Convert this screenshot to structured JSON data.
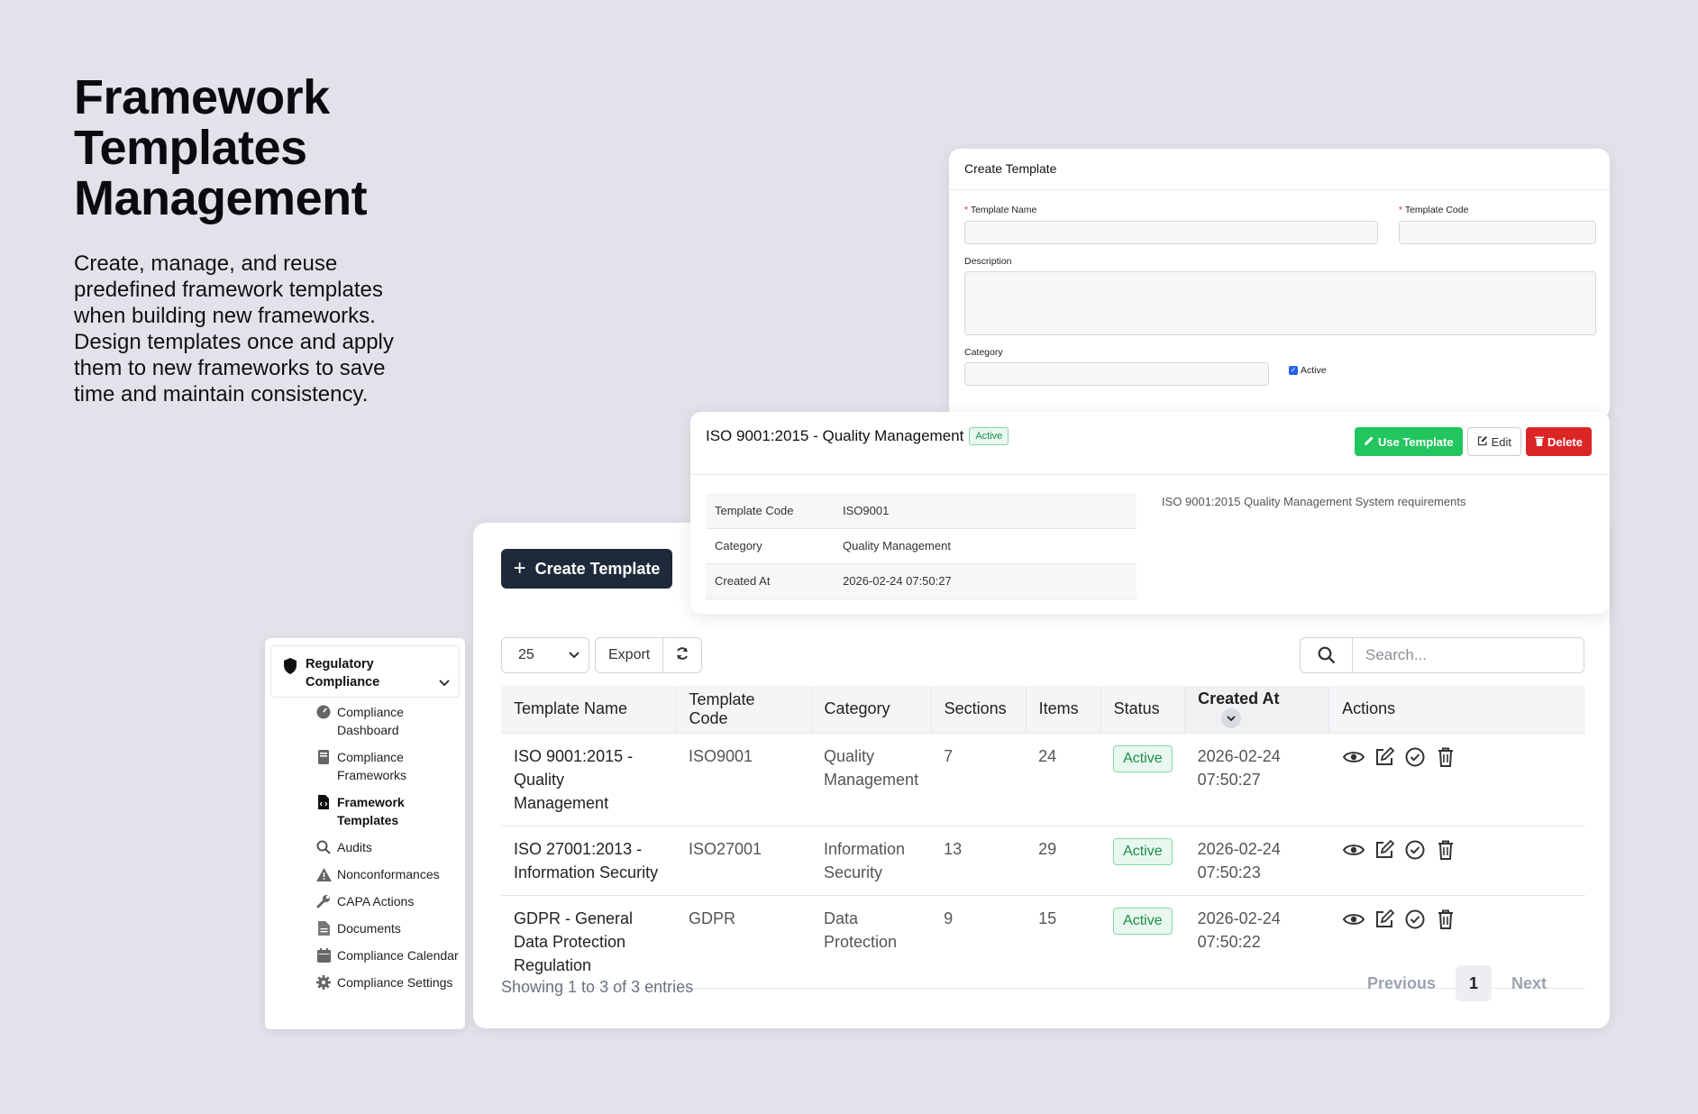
{
  "hero": {
    "title": "Framework Templates Management",
    "description": "Create, manage, and reuse predefined framework templates when building new frameworks. Design templates once and apply them to new frameworks to save time and maintain consistency."
  },
  "sidebar": {
    "section_title": "Regulatory Compliance",
    "items": [
      {
        "label": "Compliance Dashboard",
        "icon": "dashboard-icon"
      },
      {
        "label": "Compliance Frameworks",
        "icon": "book-icon"
      },
      {
        "label": "Framework Templates",
        "icon": "file-code-icon",
        "active": true
      },
      {
        "label": "Audits",
        "icon": "search-icon"
      },
      {
        "label": "Nonconformances",
        "icon": "warning-icon"
      },
      {
        "label": "CAPA Actions",
        "icon": "wrench-icon"
      },
      {
        "label": "Documents",
        "icon": "document-icon"
      },
      {
        "label": "Compliance Calendar",
        "icon": "calendar-icon"
      },
      {
        "label": "Compliance Settings",
        "icon": "gear-icon"
      }
    ]
  },
  "toolbar": {
    "create_label": "Create Template",
    "page_size": "25",
    "export_label": "Export",
    "search_placeholder": "Search..."
  },
  "table": {
    "columns": [
      "Template Name",
      "Template Code",
      "Category",
      "Sections",
      "Items",
      "Status",
      "Created At",
      "Actions"
    ],
    "rows": [
      {
        "name": "ISO 9001:2015 - Quality Management",
        "code": "ISO9001",
        "category": "Quality Management",
        "sections": "7",
        "items": "24",
        "status": "Active",
        "created": "2026-02-24 07:50:27"
      },
      {
        "name": "ISO 27001:2013 - Information Security",
        "code": "ISO27001",
        "category": "Information Security",
        "sections": "13",
        "items": "29",
        "status": "Active",
        "created": "2026-02-24 07:50:23"
      },
      {
        "name": "GDPR - General Data Protection Regulation",
        "code": "GDPR",
        "category": "Data Protection",
        "sections": "9",
        "items": "15",
        "status": "Active",
        "created": "2026-02-24 07:50:22"
      }
    ]
  },
  "footer": {
    "showing": "Showing 1 to 3 of 3 entries",
    "previous": "Previous",
    "page": "1",
    "next": "Next"
  },
  "create_form": {
    "title": "Create Template",
    "name_label": "Template Name",
    "code_label": "Template Code",
    "description_label": "Description",
    "category_label": "Category",
    "active_label": "Active",
    "required_mark": "*"
  },
  "detail": {
    "title": "ISO 9001:2015 - Quality Management",
    "status": "Active",
    "use_label": "Use Template",
    "edit_label": "Edit",
    "delete_label": "Delete",
    "fields": [
      {
        "key": "Template Code",
        "value": "ISO9001"
      },
      {
        "key": "Category",
        "value": "Quality Management"
      },
      {
        "key": "Created At",
        "value": "2026-02-24 07:50:27"
      }
    ],
    "description": "ISO 9001:2015 Quality Management System requirements"
  },
  "colors": {
    "primary_dark": "#1e2a3a",
    "success": "#22c55e",
    "danger": "#dc2626",
    "background": "#e2e3ea"
  }
}
